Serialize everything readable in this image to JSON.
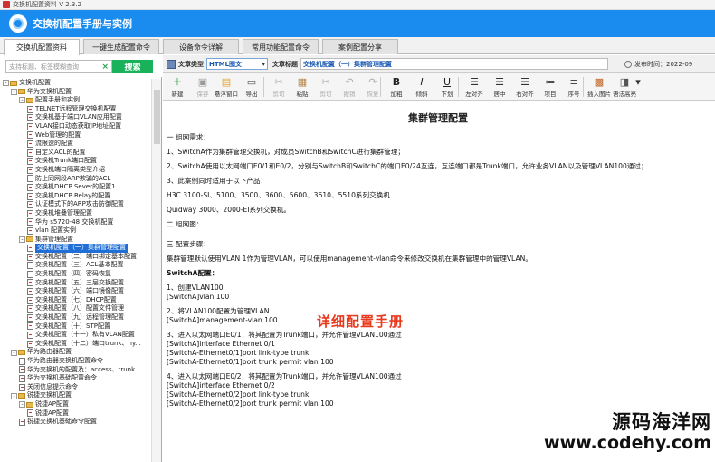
{
  "window": {
    "title": "交换机配置资料   V 2.3.2"
  },
  "banner": {
    "title": "交换机配置手册与实例"
  },
  "tabs": [
    {
      "label": "交换机配置资料",
      "active": true
    },
    {
      "label": "一键生成配置命令",
      "active": false
    },
    {
      "label": "设备命令详解",
      "active": false
    },
    {
      "label": "常用功能配置命令",
      "active": false
    },
    {
      "label": "案例配置分享",
      "active": false
    }
  ],
  "search": {
    "placeholder": "支持标题、标签模糊查询",
    "button": "搜索"
  },
  "tree": [
    {
      "level": 0,
      "type": "folder",
      "toggle": "-",
      "label": "交换机配置"
    },
    {
      "level": 1,
      "type": "folder",
      "toggle": "-",
      "label": "华为交换机配置"
    },
    {
      "level": 2,
      "type": "folder",
      "toggle": "-",
      "label": "配置手册和实例"
    },
    {
      "level": 3,
      "type": "doc",
      "label": "TELNET远程管理交换机配置"
    },
    {
      "level": 3,
      "type": "doc",
      "label": "交换机基于端口VLAN应用配置"
    },
    {
      "level": 3,
      "type": "doc",
      "label": "VLAN接口动态获取IP地址配置"
    },
    {
      "level": 3,
      "type": "doc",
      "label": "Web管理的配置"
    },
    {
      "level": 3,
      "type": "doc",
      "label": "流限速的配置"
    },
    {
      "level": 3,
      "type": "doc",
      "label": "自定义ACL的配置"
    },
    {
      "level": 3,
      "type": "doc",
      "label": "交换机Trunk端口配置"
    },
    {
      "level": 3,
      "type": "doc",
      "label": "交换机端口隔离类型介绍"
    },
    {
      "level": 3,
      "type": "doc",
      "label": "防止同网段ARP欺骗的ACL"
    },
    {
      "level": 3,
      "type": "doc",
      "label": "交换机DHCP Sever的配置1"
    },
    {
      "level": 3,
      "type": "doc",
      "label": "交换机DHCP Relay的配置"
    },
    {
      "level": 3,
      "type": "doc",
      "label": "认证模式下的ARP攻击防御配置"
    },
    {
      "level": 3,
      "type": "doc",
      "label": "交换机堆叠管理配置"
    },
    {
      "level": 3,
      "type": "doc",
      "label": "华为  s5720-48   交换机配置"
    },
    {
      "level": 3,
      "type": "doc",
      "label": "vlan 配置实例"
    },
    {
      "level": 2,
      "type": "folder",
      "toggle": "-",
      "label": "集群管理配置"
    },
    {
      "level": 3,
      "type": "doc",
      "label": "交换机配置（一）集群管理配置",
      "selected": true
    },
    {
      "level": 3,
      "type": "doc",
      "label": "交换机配置（二）端口绑定基本配置"
    },
    {
      "level": 3,
      "type": "doc",
      "label": "交换机配置（三）ACL基本配置"
    },
    {
      "level": 3,
      "type": "doc",
      "label": "交换机配置（四）密码恢复"
    },
    {
      "level": 3,
      "type": "doc",
      "label": "交换机配置（五）三层交换配置"
    },
    {
      "level": 3,
      "type": "doc",
      "label": "交换机配置（六）端口镜像配置"
    },
    {
      "level": 3,
      "type": "doc",
      "label": "交换机配置（七）DHCP配置"
    },
    {
      "level": 3,
      "type": "doc",
      "label": "交换机配置（八）配置文件管理"
    },
    {
      "level": 3,
      "type": "doc",
      "label": "交换机配置（九）远程管理配置"
    },
    {
      "level": 3,
      "type": "doc",
      "label": "交换机配置（十）STP配置"
    },
    {
      "level": 3,
      "type": "doc",
      "label": "交换机配置（十一）私有VLAN配置"
    },
    {
      "level": 3,
      "type": "doc",
      "label": "交换机配置（十二）端口trunk、hy..."
    },
    {
      "level": 1,
      "type": "folder",
      "toggle": "-",
      "label": "华为路由器配置"
    },
    {
      "level": 2,
      "type": "doc",
      "label": "华为路由器交换机配置命令"
    },
    {
      "level": 2,
      "type": "doc",
      "label": "华为交换机的配置及：access、trunk..."
    },
    {
      "level": 2,
      "type": "doc",
      "label": "华为交换机基础配置命令"
    },
    {
      "level": 2,
      "type": "doc",
      "label": "关闭信息提示命令"
    },
    {
      "level": 1,
      "type": "folder",
      "toggle": "-",
      "label": "锐捷交换机配置"
    },
    {
      "level": 2,
      "type": "folder",
      "toggle": "-",
      "label": "锐捷AP配置"
    },
    {
      "level": 3,
      "type": "doc",
      "label": "锐捷AP配置"
    },
    {
      "level": 2,
      "type": "doc",
      "label": "锐捷交换机基础命令配置"
    }
  ],
  "meta": {
    "type_label": "文章类型",
    "type_value": "HTML图文",
    "title_label": "文章标题",
    "title_value": "交换机配置（一）集群管理配置",
    "date_label": "发布时间：",
    "date_value": "2022-09"
  },
  "toolbar": [
    {
      "label": "新建",
      "icon": "new-icon",
      "glyph": "＋",
      "color": "#2e9b3a",
      "enabled": true
    },
    {
      "label": "保存",
      "icon": "save-icon",
      "glyph": "▣",
      "color": "#999",
      "enabled": false
    },
    {
      "label": "悬浮窗口",
      "icon": "float-window-icon",
      "glyph": "▤",
      "color": "#e0a020",
      "enabled": true
    },
    {
      "label": "导出",
      "icon": "export-icon",
      "glyph": "▭",
      "color": "#555",
      "enabled": true
    },
    {
      "label": "剪切",
      "icon": "cut-icon",
      "glyph": "✂",
      "color": "#aaa",
      "enabled": false
    },
    {
      "label": "粘贴",
      "icon": "paste-icon",
      "glyph": "▦",
      "color": "#b08040",
      "enabled": true
    },
    {
      "label": "剪切",
      "icon": "cut2-icon",
      "glyph": "✂",
      "color": "#aaa",
      "enabled": false
    },
    {
      "label": "撤销",
      "icon": "undo-icon",
      "glyph": "↶",
      "color": "#aaa",
      "enabled": false
    },
    {
      "label": "恢复",
      "icon": "redo-icon",
      "glyph": "↷",
      "color": "#aaa",
      "enabled": false
    },
    {
      "label": "加粗",
      "icon": "bold-icon",
      "glyph": "B",
      "color": "#222",
      "enabled": true
    },
    {
      "label": "倾斜",
      "icon": "italic-icon",
      "glyph": "I",
      "color": "#222",
      "enabled": true
    },
    {
      "label": "下划",
      "icon": "underline-icon",
      "glyph": "U",
      "color": "#222",
      "enabled": true
    },
    {
      "label": "左对齐",
      "icon": "align-left-icon",
      "glyph": "☰",
      "color": "#333",
      "enabled": true
    },
    {
      "label": "居中",
      "icon": "align-center-icon",
      "glyph": "☰",
      "color": "#333",
      "enabled": true
    },
    {
      "label": "右对齐",
      "icon": "align-right-icon",
      "glyph": "☰",
      "color": "#333",
      "enabled": true
    },
    {
      "label": "项目",
      "icon": "bullet-list-icon",
      "glyph": "≔",
      "color": "#333",
      "enabled": true
    },
    {
      "label": "序号",
      "icon": "numbered-list-icon",
      "glyph": "≡",
      "color": "#333",
      "enabled": true
    },
    {
      "label": "插入图片",
      "icon": "insert-image-icon",
      "glyph": "▩",
      "color": "#c06020",
      "enabled": true
    },
    {
      "label": "语法高亮",
      "icon": "syntax-highlight-icon",
      "glyph": "◨",
      "color": "#555",
      "enabled": true
    }
  ],
  "article": {
    "heading": "集群管理配置",
    "lines": [
      "一  组网需求：",
      "",
      "1、SwitchA作为集群管理交换机，对成员SwitchB和SwitchC进行集群管理；",
      "",
      "2、SwitchA使用以太网端口E0/1和E0/2，分别与SwitchB和SwitchC的端口E0/24互连，互连端口都是Trunk端口，允许业务VLAN以及管理VLAN100通过；",
      "",
      "3、此案例同时适用于以下产品：",
      "",
      "H3C 3100-SI、5100、3500、3600、5600、3610、5510系列交换机",
      "",
      "Quidway 3000、2000-EI系列交换机。",
      "",
      "二  组网图：",
      "",
      "",
      "三  配置步骤：",
      "",
      "集群管理默认使用VLAN 1作为管理VLAN，可以使用management-vlan命令来修改交换机在集群管理中的管理VLAN。",
      "",
      "SwitchA配置：",
      "",
      "1、创建VLAN100",
      "[SwitchA]vlan 100",
      "",
      "2、将VLAN100配置为管理VLAN",
      "[SwitchA]management-vlan 100",
      "",
      "3、进入以太网端口E0/1，将其配置为Trunk端口，并允许管理VLAN100通过",
      "[SwitchA]interface Ethernet 0/1",
      "[SwitchA-Ethernet0/1]port link-type trunk",
      "[SwitchA-Ethernet0/1]port trunk permit vlan 100",
      "",
      "4、进入以太网端口E0/2，将其配置为Trunk端口，并允许管理VLAN100通过",
      "[SwitchA]interface Ethernet 0/2",
      "[SwitchA-Ethernet0/2]port link-type trunk",
      "[SwitchA-Ethernet0/2]port trunk permit vlan 100"
    ],
    "overlay": "详细配置手册"
  },
  "watermark": {
    "line1": "源码海洋网",
    "line2": "www.codehy.com"
  },
  "colors": {
    "banner": "#1a8cf0",
    "search_button": "#19b25a",
    "selected": "#1f6fd6",
    "overlay": "#e83a1f"
  }
}
